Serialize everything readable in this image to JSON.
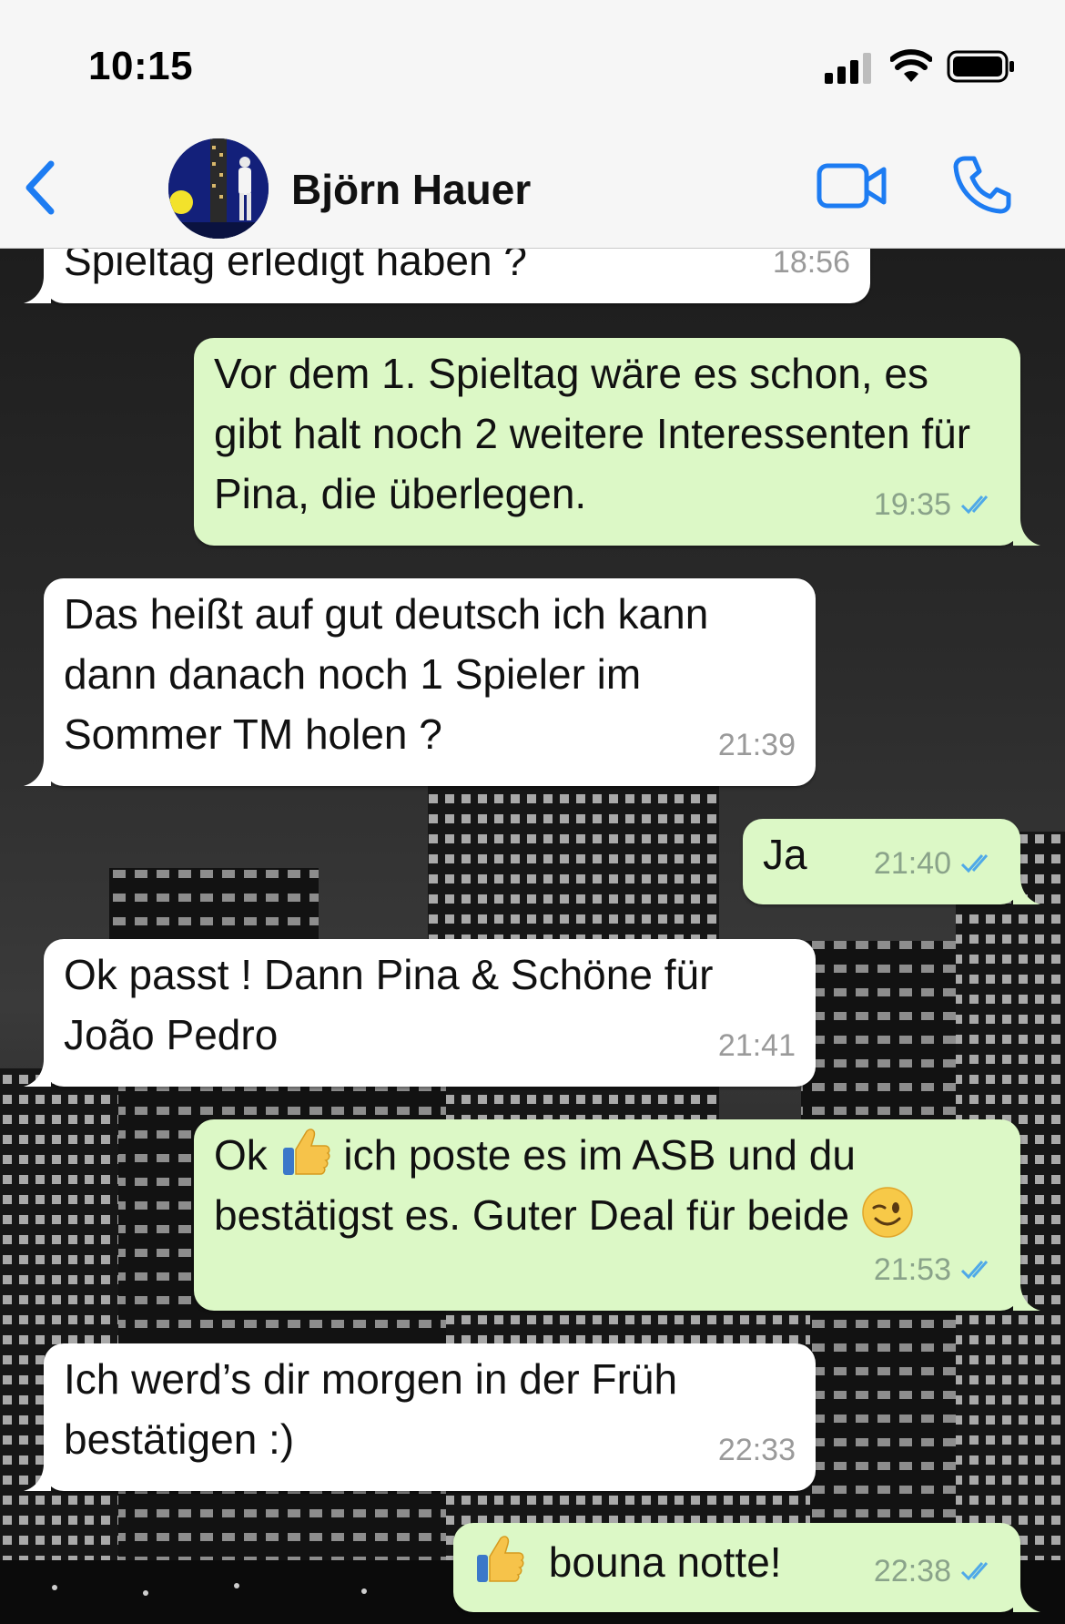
{
  "status_bar": {
    "time": "10:15"
  },
  "header": {
    "contact_name": "Björn Hauer",
    "icons": [
      "back-chevron-icon",
      "video-call-icon",
      "phone-call-icon"
    ],
    "accent_color": "#1d7cf2"
  },
  "messages": [
    {
      "direction": "in",
      "text": "Spieltag erledigt haben ?",
      "time": "18:56"
    },
    {
      "direction": "out",
      "text": "Vor dem 1. Spieltag wäre es schon, es gibt halt noch 2 weitere Interessenten für Pina, die überlegen.",
      "time": "19:35",
      "status": "read"
    },
    {
      "direction": "in",
      "text": "Das heißt auf gut deutsch ich kann dann danach noch 1 Spieler im Sommer TM holen ?",
      "time": "21:39"
    },
    {
      "direction": "out",
      "text": "Ja",
      "time": "21:40",
      "status": "read"
    },
    {
      "direction": "in",
      "text": "Ok passt ! Dann Pina & Schöne für João Pedro",
      "time": "21:41"
    },
    {
      "direction": "out",
      "text_a": "Ok",
      "text_b": "ich poste es im ASB und du bestätigst es. Guter Deal für beide",
      "emoji_1": "thumbs-up",
      "emoji_2": "winking-face",
      "time": "21:53",
      "status": "read"
    },
    {
      "direction": "in",
      "text": "Ich werd’s dir morgen in der Früh bestätigen :)",
      "time": "22:33"
    },
    {
      "direction": "out",
      "text": "bouna notte!",
      "emoji_1": "thumbs-up",
      "time": "22:38",
      "status": "read"
    }
  ],
  "colors": {
    "incoming": "#ffffff",
    "outgoing": "#dcf8c6",
    "read_tick": "#4fa9e8"
  }
}
